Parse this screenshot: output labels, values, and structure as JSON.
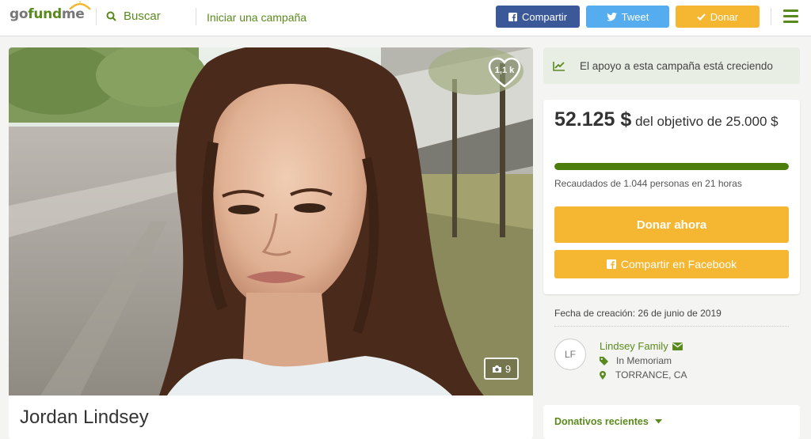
{
  "header": {
    "logo_go": "go",
    "logo_fund": "fund",
    "logo_me": "me",
    "search_label": "Buscar",
    "start_label": "Iniciar una campaña",
    "share_label": "Compartir",
    "tweet_label": "Tweet",
    "donate_label": "Donar"
  },
  "photo": {
    "likes": "1,1 k",
    "photo_count": "9"
  },
  "campaign": {
    "title": "Jordan Lindsey",
    "growing_text": "El apoyo a esta campaña está creciendo",
    "raised_amount": "52.125 $",
    "goal_text": "del objetivo de 25.000 $",
    "progress_fraction": 1.0,
    "people_text": "Recaudados de 1.044 personas en 21 horas",
    "donate_now_label": "Donar ahora",
    "share_facebook_label": "Compartir en Facebook",
    "created_text": "Fecha de creación: 26 de junio de 2019"
  },
  "organizer": {
    "initials": "LF",
    "name": "Lindsey Family",
    "category": "In Memoriam",
    "location": "TORRANCE, CA"
  },
  "donations": {
    "label": "Donativos recientes"
  },
  "colors": {
    "brand_green": "#5a8a1e",
    "donate_yellow": "#f5b731",
    "facebook_blue": "#3b5998",
    "twitter_blue": "#55acee",
    "progress_green": "#4c7d0d"
  },
  "icons": [
    "search-icon",
    "facebook-icon",
    "twitter-icon",
    "check-icon",
    "menu-icon",
    "heart-icon",
    "camera-icon",
    "trending-up-icon",
    "envelope-icon",
    "tag-icon",
    "map-pin-icon",
    "chevron-down-icon"
  ]
}
